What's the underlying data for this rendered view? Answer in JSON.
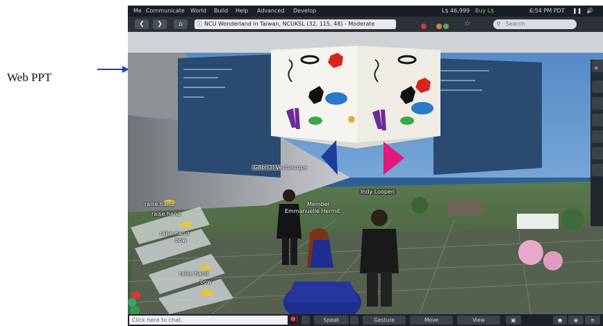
{
  "annotation": {
    "label": "Web PPT"
  },
  "menu": [
    "Me",
    "Communicate",
    "World",
    "Build",
    "Help",
    "Advanced",
    "Develop"
  ],
  "status": {
    "balance": "L$ 46,999",
    "buy": "Buy L$",
    "time": "6:54 PM PDT"
  },
  "navbar": {
    "location": "NCU Wonderland in Taiwan, NCUKSL (32, 115, 48) - Moderate",
    "search_placeholder": "Search"
  },
  "avatars": {
    "vectoscope": "G8bri3l Vectoscope",
    "loopen": "Indy Loopen",
    "member_title": "Member",
    "hermit": "Emmanuelle Hermit"
  },
  "gestures": {
    "raise_hand_1": "raise hand",
    "raise_hand_2": "raise hand",
    "raise_hand_3": "raise hand",
    "bow_1": "bow",
    "raise_hand_4": "raise hand",
    "bow_2": "bow"
  },
  "bottombar": {
    "chat_placeholder": "Click here to chat.",
    "speak": "Speak",
    "gesture": "Gesture",
    "move": "Move",
    "view": "View"
  },
  "colors": {
    "arrow": "#1a3fd0",
    "sky": "#6fa4d8",
    "sea": "#2f5f94",
    "dress": "#1e2f8f",
    "cube_left": "#1a3f9a",
    "cube_right": "#e0197a"
  }
}
